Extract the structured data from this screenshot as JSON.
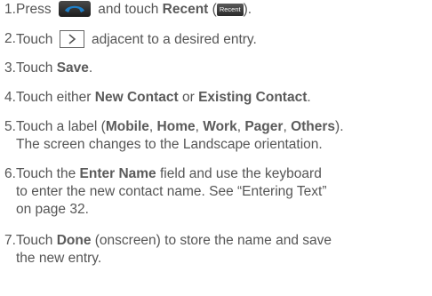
{
  "steps": [
    {
      "number": "1.",
      "parts": [
        "Press",
        "and touch",
        "Recent",
        "(",
        ")."
      ],
      "icon_phone": "phone-handset-icon",
      "icon_recent_label": "Recent"
    },
    {
      "number": "2.",
      "parts": [
        "Touch",
        "adjacent to a desired entry."
      ],
      "icon": "chevron-right-icon"
    },
    {
      "number": "3.",
      "parts": [
        "Touch",
        "Save",
        "."
      ]
    },
    {
      "number": "4.",
      "parts": [
        "Touch either",
        "New Contact",
        "or",
        "Existing Contact",
        "."
      ]
    },
    {
      "number": "5.",
      "parts": [
        "Touch a label (",
        "Mobile",
        ",",
        "Home",
        ",",
        "Work",
        ",",
        "Pager",
        ",",
        "Others",
        ").",
        "The screen changes to the Landscape orientation."
      ]
    },
    {
      "number": "6.",
      "parts": [
        "Touch the",
        "Enter Name",
        "field and use the keyboard",
        "to enter the new contact name. See “Entering Text”",
        "on page 32."
      ]
    },
    {
      "number": "7.",
      "parts": [
        "Touch",
        "Done",
        "(onscreen) to store the name and save",
        "the new entry."
      ]
    }
  ],
  "colors": {
    "text": "#555555",
    "phone_icon_bg": "#2b2b2b",
    "phone_handset": "#1e7fc8"
  }
}
